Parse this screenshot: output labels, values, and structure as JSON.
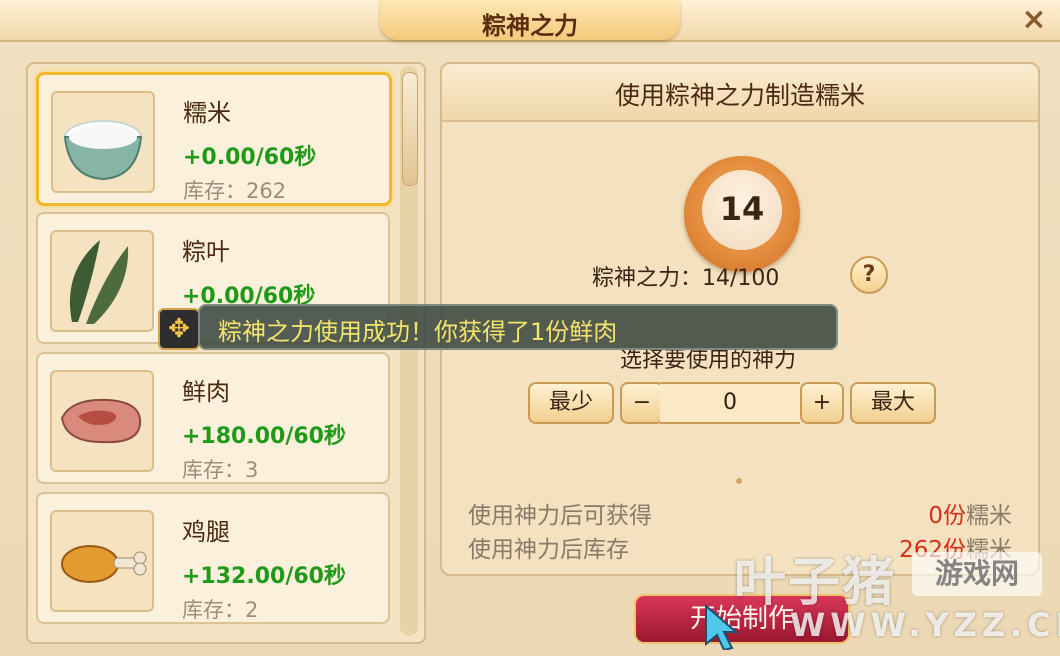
{
  "window": {
    "title": "粽神之力"
  },
  "items": [
    {
      "name": "糯米",
      "rate": "+0.00/60秒",
      "stock": "库存：262",
      "icon": "rice-bowl-icon",
      "selected": true
    },
    {
      "name": "粽叶",
      "rate": "+0.00/60秒",
      "stock": "",
      "icon": "bamboo-leaf-icon"
    },
    {
      "name": "鲜肉",
      "rate": "+180.00/60秒",
      "stock": "库存：3",
      "icon": "meat-icon"
    },
    {
      "name": "鸡腿",
      "rate": "+132.00/60秒",
      "stock": "库存：2",
      "icon": "drumstick-icon"
    }
  ],
  "craft": {
    "title": "使用粽神之力制造糯米",
    "power_value": "14",
    "power_label": "粽神之力：14/100",
    "help": "?",
    "select_label": "选择要使用的神力",
    "min_label": "最少",
    "minus": "−",
    "quantity": "0",
    "plus": "+",
    "max_label": "最大",
    "gain_label": "使用神力后可获得",
    "gain_value": "0份",
    "gain_unit": "糯米",
    "stock_label": "使用神力后库存",
    "stock_value": "262份",
    "stock_unit": "糯米",
    "start_label": "开始制作"
  },
  "toast": {
    "text": "粽神之力使用成功！你获得了1份鲜肉"
  },
  "watermark": {
    "main": "叶子猪",
    "box": "游戏网",
    "url": "WWW.YZZ.CN"
  },
  "colors": {
    "rate_green": "#1f9a18",
    "highlight_red": "#d62d1a",
    "selected_border": "#f3b72a"
  }
}
